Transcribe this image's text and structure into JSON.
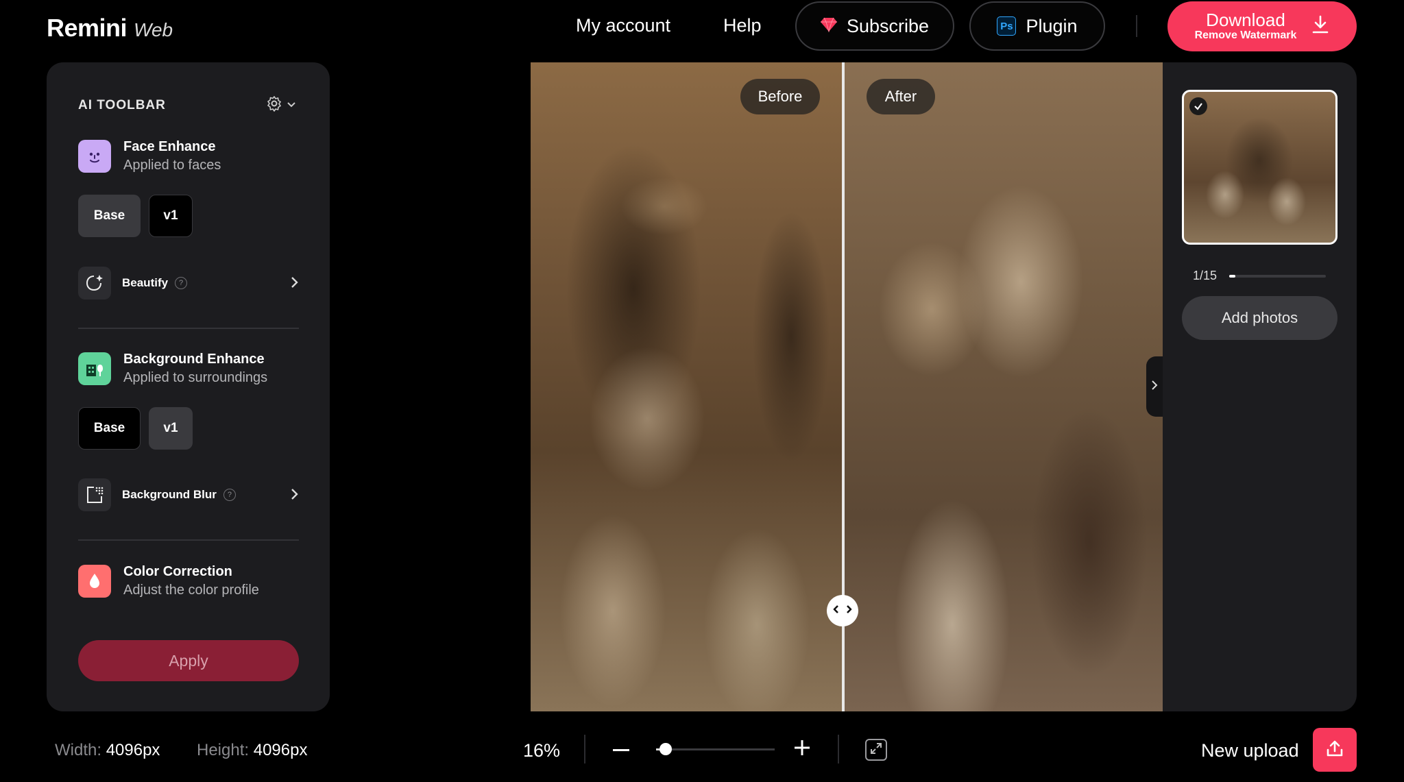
{
  "header": {
    "brand": "Remini",
    "brand_suffix": "Web",
    "nav": {
      "my_account": "My account",
      "help": "Help"
    },
    "subscribe_label": "Subscribe",
    "plugin_label": "Plugin",
    "plugin_icon_text": "Ps",
    "download_label": "Download",
    "download_sub": "Remove Watermark",
    "accent_color": "#f7385b"
  },
  "toolbar": {
    "title": "AI TOOLBAR",
    "face": {
      "name": "Face Enhance",
      "desc": "Applied to faces",
      "options": [
        "Base",
        "v1"
      ],
      "selected": "Base"
    },
    "beautify": {
      "label": "Beautify"
    },
    "background": {
      "name": "Background Enhance",
      "desc": "Applied to surroundings",
      "options": [
        "Base",
        "v1"
      ],
      "selected": "v1"
    },
    "blur": {
      "label": "Background Blur"
    },
    "color": {
      "name": "Color Correction",
      "desc": "Adjust the color profile"
    },
    "apply_label": "Apply",
    "help_glyph": "?"
  },
  "compare": {
    "before_label": "Before",
    "after_label": "After"
  },
  "gallery": {
    "counter": "1/15",
    "progress": 0.0667,
    "add_photos_label": "Add photos"
  },
  "footer": {
    "width_key": "Width:",
    "width_val": "4096px",
    "height_key": "Height:",
    "height_val": "4096px",
    "zoom": "16%",
    "zoom_level": 0.08,
    "new_upload_label": "New upload"
  }
}
